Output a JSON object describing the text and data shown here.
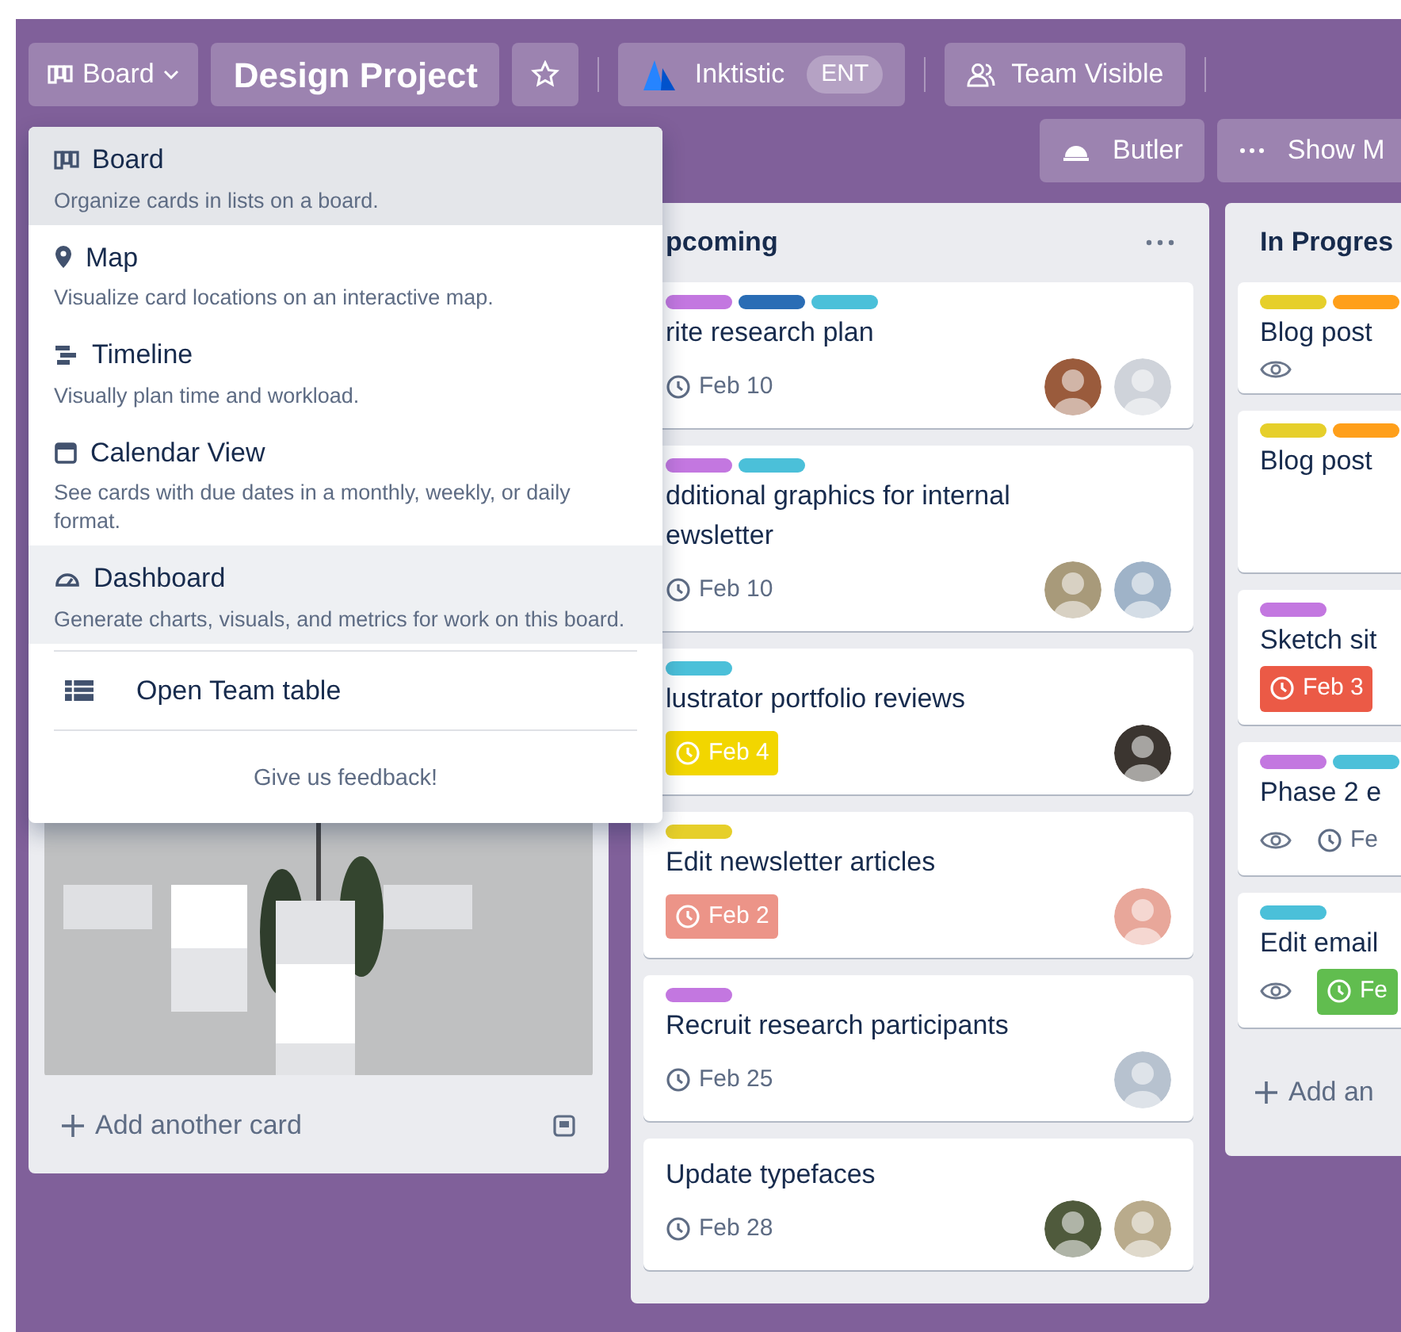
{
  "header": {
    "switcher": "Board",
    "title": "Design Project",
    "starred": false,
    "workspace": {
      "name": "Inktistic",
      "badge": "ENT"
    },
    "visibility": "Team Visible"
  },
  "actions": [
    {
      "kind": "butler",
      "label": "Butler"
    },
    {
      "kind": "more",
      "label": "Show M"
    }
  ],
  "view_menu": {
    "items": [
      {
        "kind": "board",
        "title": "Board",
        "description": "Organize cards in lists on a board.",
        "selected": true,
        "hovered": false
      },
      {
        "kind": "map",
        "title": "Map",
        "description": "Visualize card locations on an interactive map.",
        "selected": false,
        "hovered": false
      },
      {
        "kind": "timeline",
        "title": "Timeline",
        "description": "Visually plan time and workload.",
        "selected": false,
        "hovered": false
      },
      {
        "kind": "calendar",
        "title": "Calendar View",
        "description": "See cards with due dates in a monthly, weekly, or daily format.",
        "selected": false,
        "hovered": false
      },
      {
        "kind": "dashboard",
        "title": "Dashboard",
        "description": "Generate charts, visuals, and metrics for work on this board.",
        "selected": false,
        "hovered": true
      }
    ],
    "link": "Open Team table",
    "feedback": "Give us feedback!"
  },
  "lists": [
    {
      "kind": "covered",
      "add_label": "Add another card"
    },
    {
      "kind": "open",
      "title": "pcoming",
      "cards": [
        {
          "kind": "task",
          "labels": [
            {
              "color": "#c377e0"
            },
            {
              "color": "#2a6db5"
            },
            {
              "color": "#4bc0d9"
            }
          ],
          "title": "rite research plan",
          "due": {
            "text": "Feb 10"
          },
          "members": [
            {
              "color": "#9a5b3c"
            },
            {
              "color": "#cfd3da"
            }
          ]
        },
        {
          "kind": "task",
          "labels": [
            {
              "color": "#c377e0"
            },
            {
              "color": "#4bc0d9"
            }
          ],
          "title": "dditional graphics for internal\newsletter",
          "due": {
            "text": "Feb 10"
          },
          "members": [
            {
              "color": "#a89a7a"
            },
            {
              "color": "#9fb3c8"
            }
          ]
        },
        {
          "kind": "task",
          "labels": [
            {
              "color": "#4bc0d9"
            }
          ],
          "title": "lustrator portfolio reviews",
          "due": {
            "text": "Feb 4",
            "color": "#f2d600"
          },
          "members": [
            {
              "color": "#3b3530"
            }
          ]
        },
        {
          "kind": "task",
          "labels": [
            {
              "color": "#e6cf2a"
            }
          ],
          "title": "Edit newsletter articles",
          "due": {
            "text": "Feb 2",
            "color": "#ec9488"
          },
          "members": [
            {
              "color": "#e8a79a"
            }
          ]
        },
        {
          "kind": "task",
          "labels": [
            {
              "color": "#c377e0"
            }
          ],
          "title": "Recruit research participants",
          "due": {
            "text": "Feb 25"
          },
          "members": [
            {
              "color": "#b7c2cf"
            }
          ]
        },
        {
          "kind": "task",
          "title": "Update typefaces",
          "due": {
            "text": "Feb 28"
          },
          "members": [
            {
              "color": "#4f5a3c"
            },
            {
              "color": "#b9ab8c"
            }
          ]
        }
      ]
    },
    {
      "kind": "open",
      "title": "In Progres",
      "cards": [
        {
          "kind": "task",
          "labels": [
            {
              "color": "#e6cf2a"
            },
            {
              "color": "#ff9f1a"
            }
          ],
          "title": "Blog post",
          "watching": true
        },
        {
          "kind": "task",
          "labels": [
            {
              "color": "#e6cf2a"
            },
            {
              "color": "#ff9f1a"
            }
          ],
          "title": "Blog post"
        },
        {
          "kind": "task",
          "labels": [
            {
              "color": "#c377e0"
            }
          ],
          "title": "Sketch sit",
          "due": {
            "text": "Feb 3",
            "color": "#eb5a46"
          }
        },
        {
          "kind": "task",
          "labels": [
            {
              "color": "#c377e0"
            },
            {
              "color": "#4bc0d9"
            }
          ],
          "title": "Phase 2 e",
          "watching": true,
          "due": {
            "text": "Fe"
          }
        },
        {
          "kind": "task",
          "labels": [
            {
              "color": "#4bc0d9"
            }
          ],
          "title": "Edit email",
          "watching": true,
          "due": {
            "text": "Fe",
            "color": "#61bd4f"
          }
        }
      ],
      "add_label": "Add an"
    }
  ]
}
